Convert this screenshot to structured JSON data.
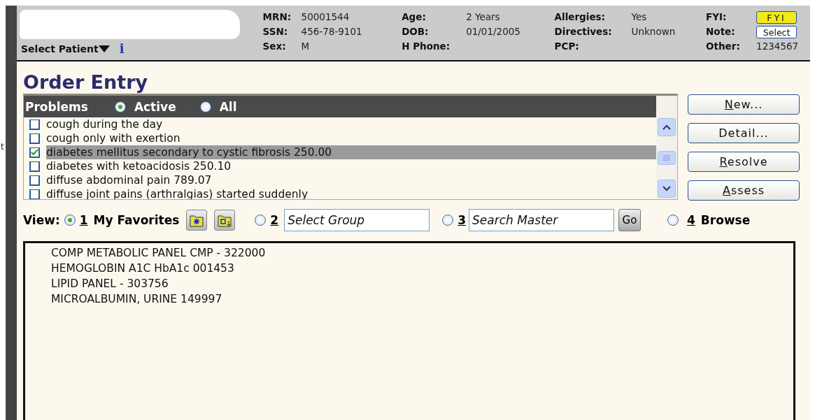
{
  "edge_fragment": "t",
  "patient": {
    "select_label": "Select Patient",
    "info": "i",
    "columns": [
      {
        "fields": [
          {
            "label": "MRN:",
            "value": "50001544",
            "kind": "text"
          },
          {
            "label": "SSN:",
            "value": "456-78-9101",
            "kind": "text"
          },
          {
            "label": "Sex:",
            "value": "M",
            "kind": "text"
          }
        ]
      },
      {
        "fields": [
          {
            "label": "Age:",
            "value": "2 Years",
            "kind": "text"
          },
          {
            "label": "DOB:",
            "value": "01/01/2005",
            "kind": "text"
          },
          {
            "label": "H Phone:",
            "kind": "text"
          }
        ]
      },
      {
        "fields": [
          {
            "label": "Allergies:",
            "value": "Yes",
            "kind": "text"
          },
          {
            "label": "Directives:",
            "value": "Unknown",
            "kind": "text"
          },
          {
            "label": "PCP:",
            "kind": "text"
          }
        ]
      },
      {
        "fields": [
          {
            "label": "FYI:",
            "value": "FYI",
            "kind": "flag"
          },
          {
            "label": "Note:",
            "value": "Select",
            "kind": "button"
          },
          {
            "label": "Other:",
            "value": "1234567",
            "kind": "text"
          }
        ]
      }
    ]
  },
  "title": "Order Entry",
  "problems": {
    "heading": "Problems",
    "filters": [
      {
        "label": "Active",
        "selected": true
      },
      {
        "label": "All",
        "selected": false
      }
    ],
    "rows": [
      {
        "text": "cough during the day",
        "checked": false,
        "selected": false
      },
      {
        "text": "cough only with exertion",
        "checked": false,
        "selected": false
      },
      {
        "text": "diabetes mellitus secondary to cystic fibrosis 250.00",
        "checked": true,
        "selected": true
      },
      {
        "text": "diabetes with ketoacidosis 250.10",
        "checked": false,
        "selected": false
      },
      {
        "text": "diffuse abdominal pain 789.07",
        "checked": false,
        "selected": false
      },
      {
        "text": "diffuse joint pains (arthralgias) started suddenly",
        "checked": false,
        "selected": false
      }
    ]
  },
  "actions": [
    {
      "label": "New...",
      "underline_first": true
    },
    {
      "label": "Detail...",
      "underline_first": false
    },
    {
      "label": "Resolve",
      "underline_first": true
    },
    {
      "label": "Assess",
      "underline_first": true
    }
  ],
  "view": {
    "label": "View:",
    "options": [
      {
        "number": "1",
        "label": "My Favorites",
        "kind": "favorites",
        "selected": true
      },
      {
        "number": "2",
        "placeholder": "Select Group",
        "kind": "group",
        "selected": false
      },
      {
        "number": "3",
        "placeholder": "Search Master",
        "go": "Go",
        "kind": "search",
        "selected": false
      },
      {
        "number": "4",
        "label": "Browse",
        "kind": "browse",
        "selected": false
      }
    ]
  },
  "favorites": [
    "COMP METABOLIC PANEL CMP - 322000",
    "HEMOGLOBIN A1C HbA1c 001453",
    "LIPID PANEL - 303756",
    "MICROALBUMIN, URINE 149997"
  ]
}
